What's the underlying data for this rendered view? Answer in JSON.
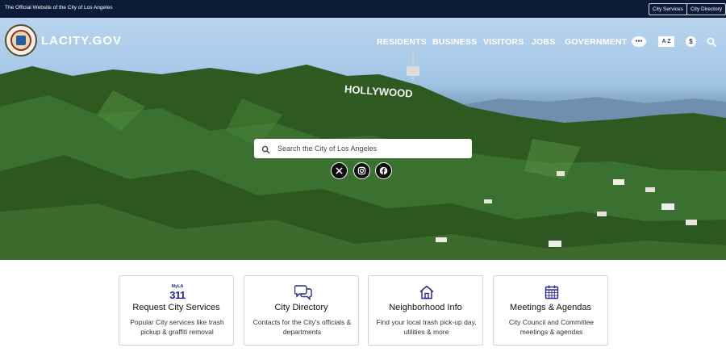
{
  "topbar": {
    "official_text": "The Official Website of the City of Los Angeles",
    "city_services_label": "City Services",
    "city_directory_label": "City Directory"
  },
  "header": {
    "logo_text": "LACITY.GOV",
    "nav": [
      "RESIDENTS",
      "BUSINESS",
      "VISITORS",
      "JOBS",
      "GOVERNMENT"
    ],
    "icons": [
      "language-icon",
      "a-to-z-icon",
      "payment-icon",
      "search-icon"
    ],
    "az_label": "A Z",
    "pay_label": "$"
  },
  "hero": {
    "hollywood_sign_text": "HOLLYWOOD",
    "search_placeholder": "Search the City of Los Angeles",
    "social": [
      "x-icon",
      "instagram-icon",
      "facebook-icon"
    ]
  },
  "cards": [
    {
      "icon": "myla311-logo",
      "logo_top": "MyLA",
      "logo_num": "311",
      "title": "Request City Services",
      "description": "Popular City services like trash pickup & graffiti removal"
    },
    {
      "icon": "chat-bubbles-icon",
      "title": "City Directory",
      "description": "Contacts for the City's officials & departments"
    },
    {
      "icon": "home-icon",
      "title": "Neighborhood Info",
      "description": "Find your local trash pick-up day, utilities & more"
    },
    {
      "icon": "calendar-icon",
      "title": "Meetings & Agendas",
      "description": "City Council and Committee meetings & agendas"
    }
  ],
  "colors": {
    "topbar_bg": "#0c1c38",
    "accent": "#2a2a8c",
    "card_border": "#cfd5de"
  }
}
